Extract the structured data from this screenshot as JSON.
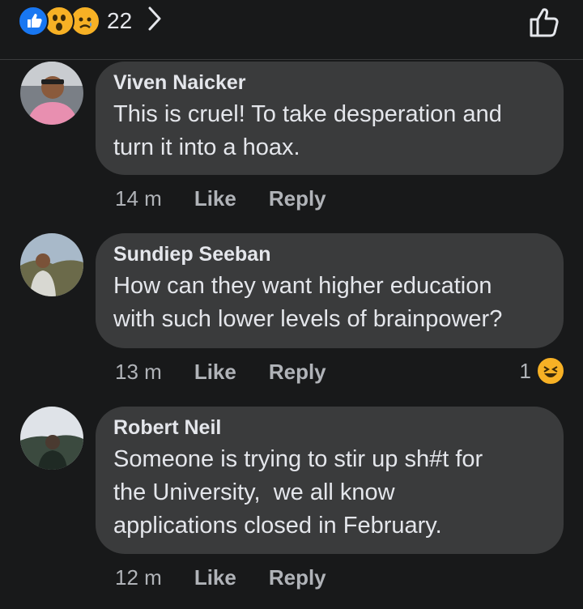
{
  "reactions": {
    "count": "22",
    "icons": [
      "like-icon",
      "wow-icon",
      "sad-icon"
    ]
  },
  "comments": [
    {
      "author": "Viven Naicker",
      "text_lines": [
        "This is cruel! To take desperation and",
        "turn it into a hoax."
      ],
      "time": "14 m",
      "like": "Like",
      "reply": "Reply"
    },
    {
      "author": "Sundiep Seeban",
      "text_lines": [
        "How can they want higher education",
        "with such lower levels of brainpower?"
      ],
      "time": "13 m",
      "like": "Like",
      "reply": "Reply",
      "reaction_count": "1",
      "reaction_icon": "laughing-emoji-icon"
    },
    {
      "author": "Robert Neil",
      "text_lines": [
        "Someone is trying to stir up sh#t for",
        "the University,  we all know",
        "applications closed in February."
      ],
      "time": "12 m",
      "like": "Like",
      "reply": "Reply"
    }
  ],
  "colors": {
    "background": "#18191a",
    "bubble": "#3a3b3c",
    "text": "#e4e6eb",
    "meta": "#b0b3b8",
    "like_blue": "#1877f2",
    "emoji_yellow": "#f7b125"
  }
}
